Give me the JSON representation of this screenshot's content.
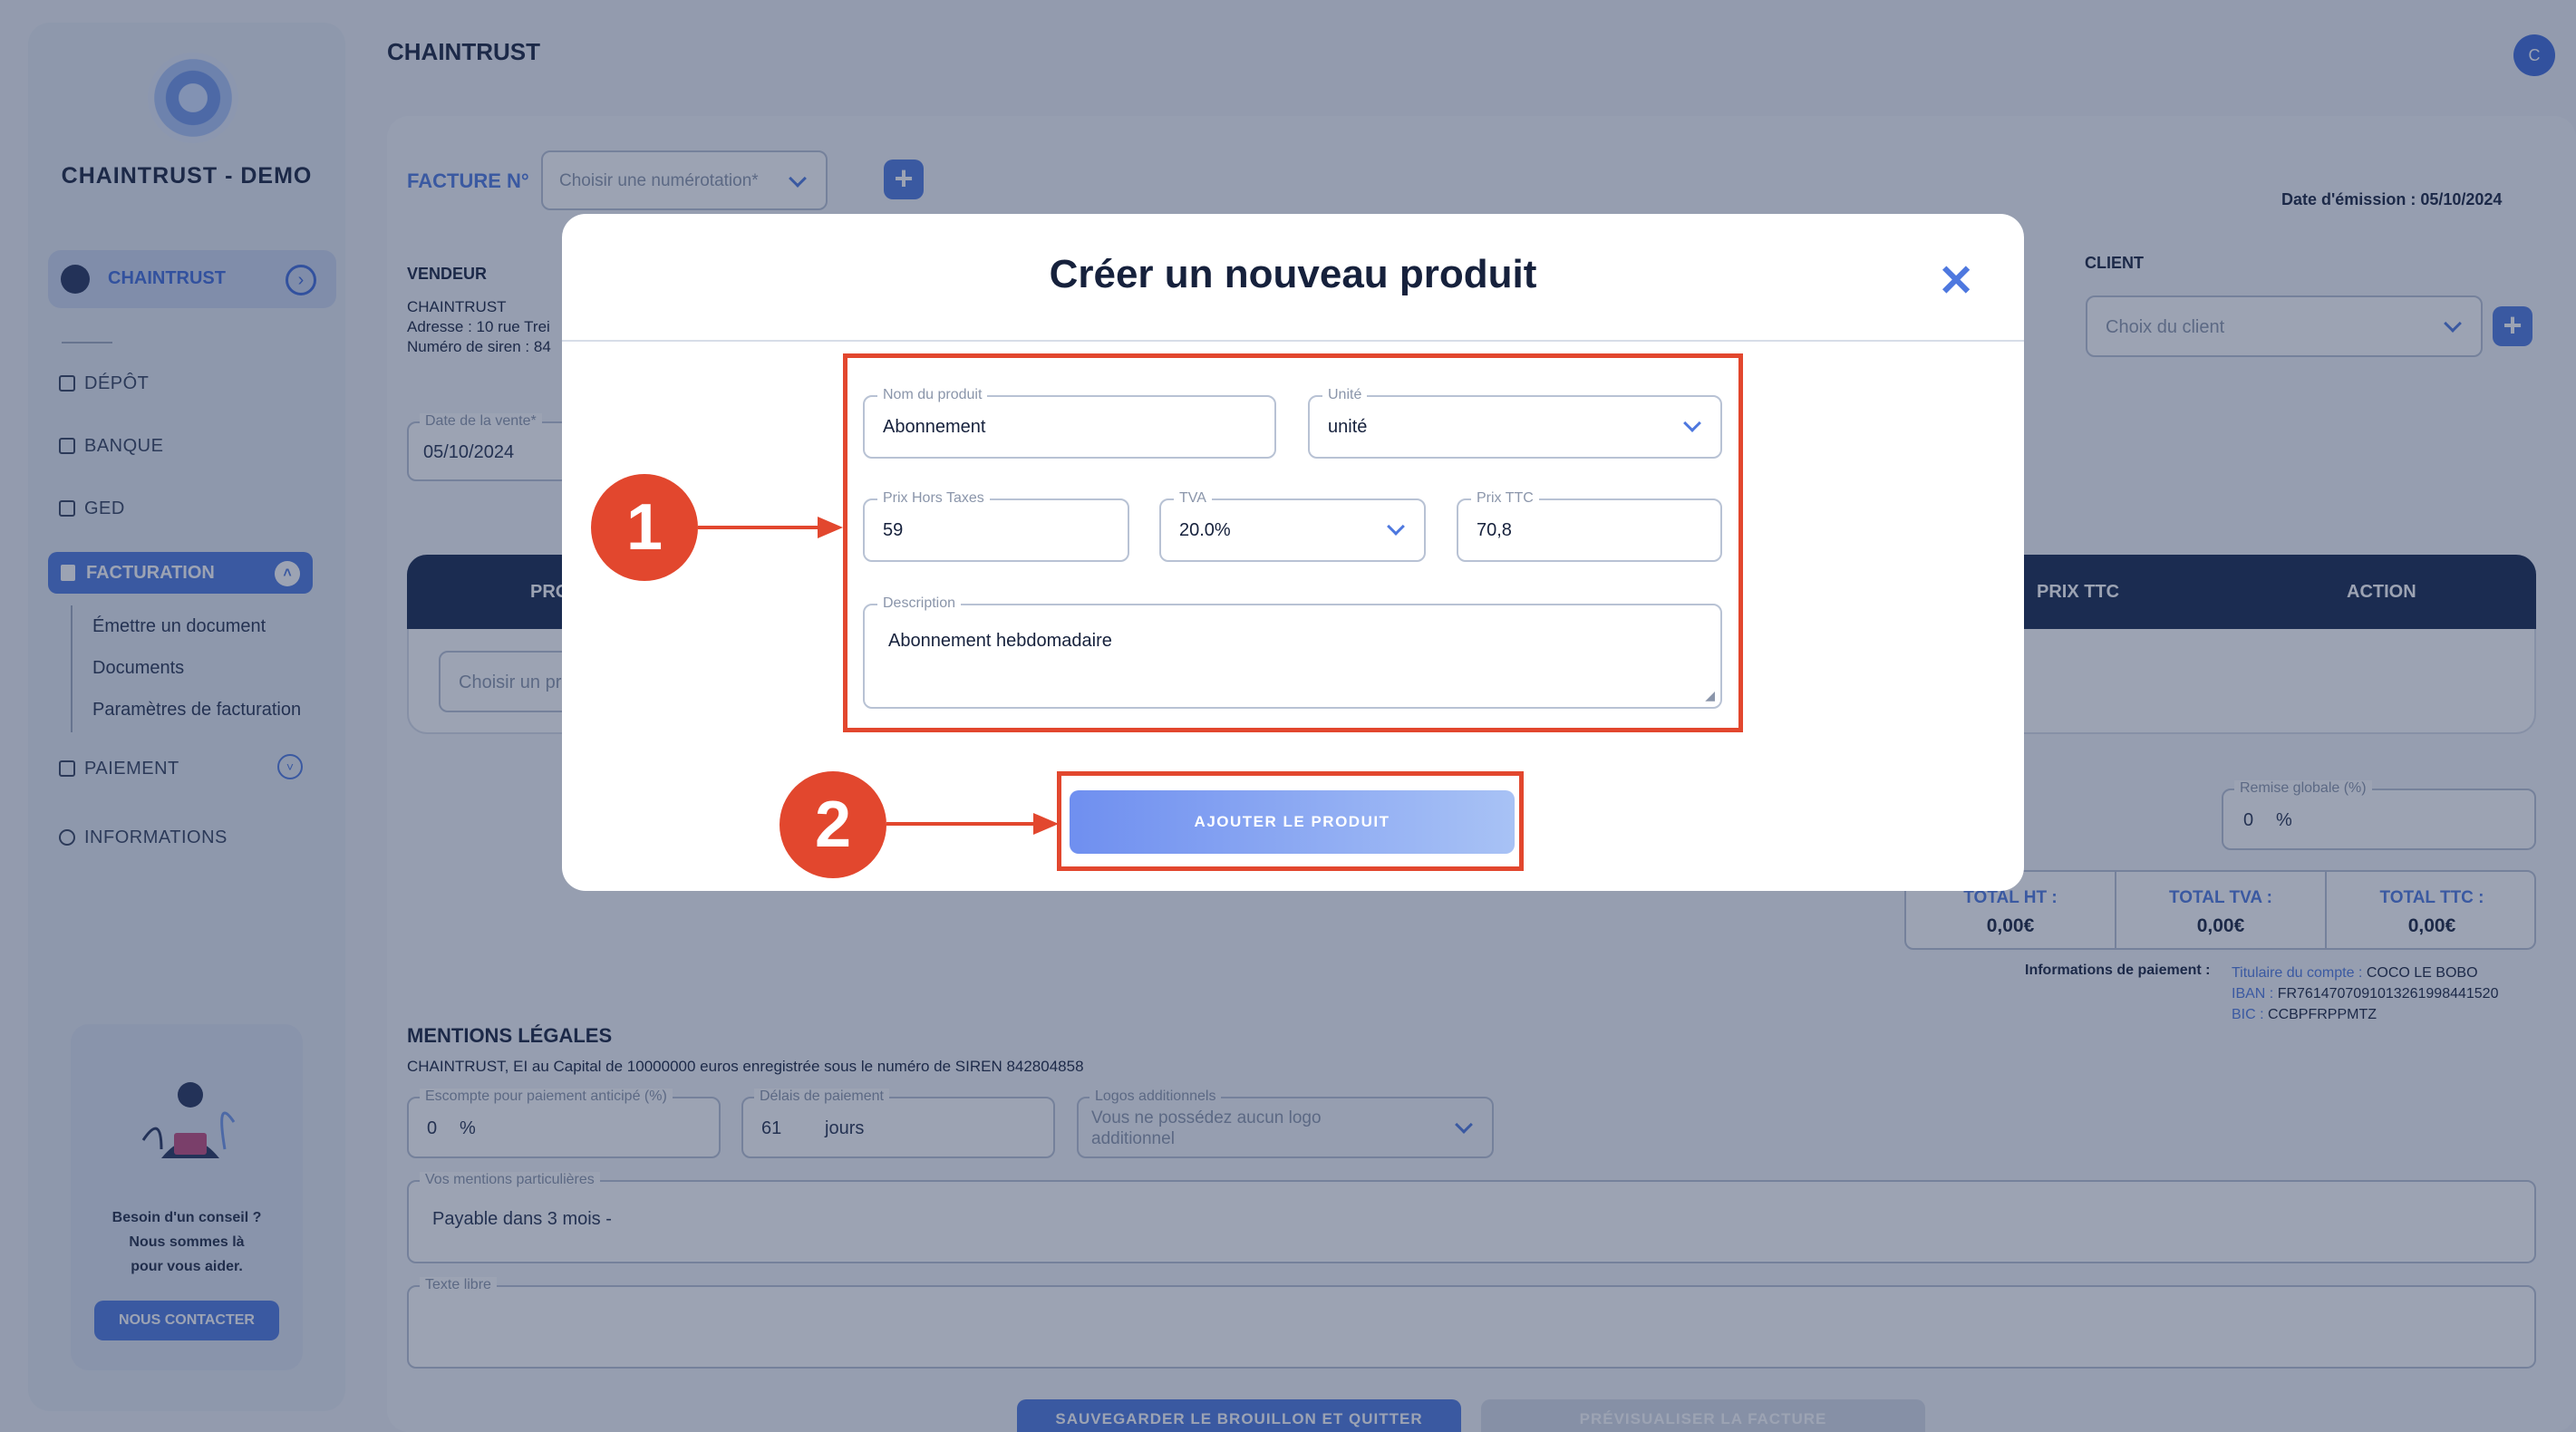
{
  "app": {
    "title": "CHAINTRUST",
    "avatar_letter": "C"
  },
  "sidebar": {
    "brand": "CHAINTRUST - DEMO",
    "company": "CHAINTRUST",
    "items": [
      "DÉPÔT",
      "BANQUE",
      "GED"
    ],
    "facturation": "FACTURATION",
    "sub_items": [
      "Émettre un document",
      "Documents",
      "Paramètres de facturation"
    ],
    "paiement": "PAIEMENT",
    "informations": "INFORMATIONS",
    "help": {
      "line1": "Besoin d'un conseil ?",
      "line2": "Nous sommes là",
      "line3": "pour vous aider.",
      "button": "NOUS CONTACTER"
    }
  },
  "invoice": {
    "facture_label": "FACTURE N°",
    "numerotation_placeholder": "Choisir une numérotation*",
    "date_emission_label": "Date d'émission  :",
    "date_emission": "05/10/2024",
    "vendeur_label": "VENDEUR",
    "vendeur_name": "CHAINTRUST",
    "adresse_label": "Adresse :",
    "adresse_value": "10 rue Trei",
    "siren_label": "Numéro de siren :",
    "siren_value": "84",
    "date_vente_label": "Date de la vente*",
    "date_vente": "05/10/2024",
    "client_label": "CLIENT",
    "client_placeholder": "Choix du client",
    "table_headers": {
      "col1": "PRO",
      "prix_ttc": "PRIX TTC",
      "action": "ACTION"
    },
    "product_placeholder": "Choisir un pr",
    "remise_label": "Remise globale (%)",
    "remise_value": "0",
    "percent": "%",
    "totals": [
      {
        "label": "TOTAL HT :",
        "value": "0,00€"
      },
      {
        "label": "TOTAL TVA :",
        "value": "0,00€"
      },
      {
        "label": "TOTAL TTC :",
        "value": "0,00€"
      }
    ],
    "payment": {
      "label": "Informations de paiement :",
      "titulaire_label": "Titulaire du compte :",
      "titulaire": "COCO LE BOBO",
      "iban_label": "IBAN :",
      "iban": "FR7614707091013261998441520",
      "bic_label": "BIC :",
      "bic": "CCBPFRPPMTZ"
    },
    "mentions_title": "MENTIONS LÉGALES",
    "mentions_text": "CHAINTRUST, EI au Capital de 10000000 euros enregistrée sous le numéro de SIREN 842804858",
    "escompte_label": "Escompte pour paiement anticipé (%)",
    "escompte_value": "0",
    "delais_label": "Délais de paiement",
    "delais_value": "61",
    "delais_unit": "jours",
    "logos_label": "Logos additionnels",
    "logos_value": "Vous ne possédez aucun logo additionnel",
    "mentions_part_label": "Vos mentions particulières",
    "mentions_part_value": "Payable dans 3 mois -",
    "texte_libre_label": "Texte libre",
    "save_button": "SAUVEGARDER LE BROUILLON ET QUITTER",
    "preview_button": "PRÉVISUALISER LA FACTURE"
  },
  "modal": {
    "title": "Créer un nouveau produit",
    "nom_label": "Nom du produit",
    "nom_value": "Abonnement",
    "unite_label": "Unité",
    "unite_value": "unité",
    "prix_ht_label": "Prix Hors Taxes",
    "prix_ht_value": "59",
    "tva_label": "TVA",
    "tva_value": "20.0%",
    "prix_ttc_label": "Prix TTC",
    "prix_ttc_value": "70,8",
    "description_label": "Description",
    "description_value": "Abonnement hebdomadaire",
    "add_button": "AJOUTER LE PRODUIT",
    "callout1": "1",
    "callout2": "2"
  },
  "colors": {
    "accent": "#4e78df",
    "navy": "#15274d",
    "annotation": "#e2472e"
  }
}
